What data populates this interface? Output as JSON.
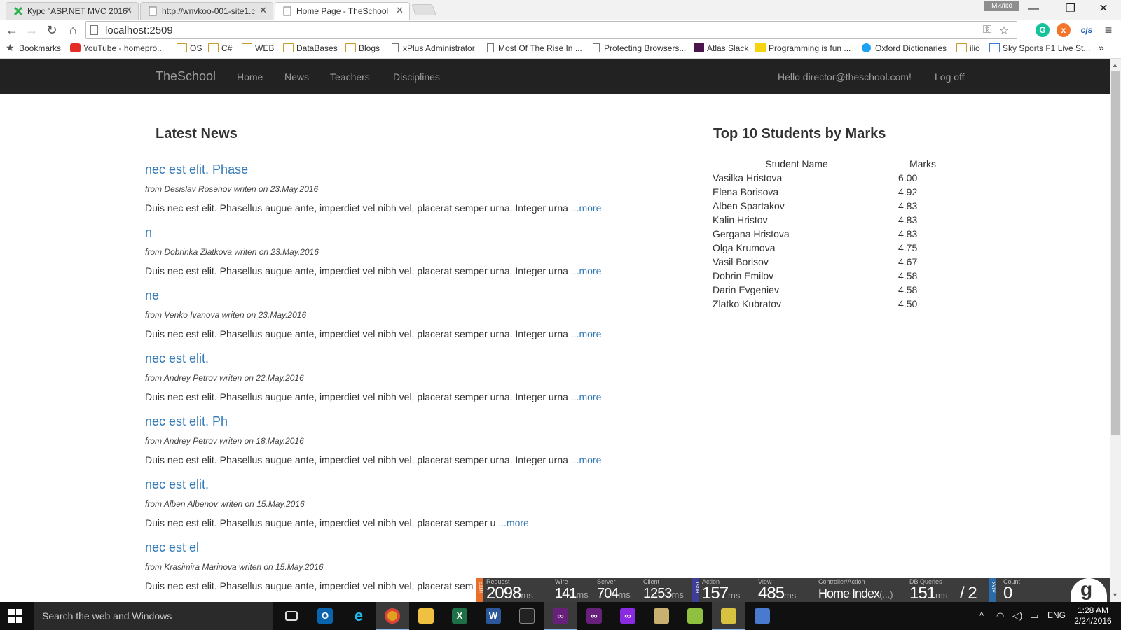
{
  "browser": {
    "tabs": [
      {
        "title": "Курс \"ASP.NET MVC 2016\"",
        "favicon_color": "#2bb24c",
        "active": false
      },
      {
        "title": "http://wnvkoo-001-site1.c",
        "favicon_color": "#777777",
        "active": false
      },
      {
        "title": "Home Page - TheSchool",
        "favicon_color": "#777777",
        "active": true
      }
    ],
    "user_badge": "Милко",
    "url": "localhost:2509",
    "extensions": {
      "grammarly": "G",
      "other": "x",
      "cjs": "cjs"
    },
    "bookmarks": [
      {
        "label": "Bookmarks",
        "icon": "star-icon"
      },
      {
        "label": "YouTube - homepro...",
        "icon": "youtube-icon"
      },
      {
        "label": "OS",
        "icon": "folder-icon"
      },
      {
        "label": "C#",
        "icon": "folder-icon"
      },
      {
        "label": "WEB",
        "icon": "folder-icon"
      },
      {
        "label": "DataBases",
        "icon": "folder-icon"
      },
      {
        "label": "Blogs",
        "icon": "folder-icon"
      },
      {
        "label": "xPlus Administrator",
        "icon": "page-icon"
      },
      {
        "label": "Most Of The Rise In ...",
        "icon": "page-icon"
      },
      {
        "label": "Protecting Browsers...",
        "icon": "page-icon"
      },
      {
        "label": "Atlas Slack",
        "icon": "slack-icon"
      },
      {
        "label": "Programming is fun ...",
        "icon": "programming-icon"
      },
      {
        "label": "Oxford Dictionaries",
        "icon": "oxford-icon"
      },
      {
        "label": "ilio",
        "icon": "folder-icon"
      },
      {
        "label": "Sky Sports F1 Live St...",
        "icon": "sky-icon"
      }
    ],
    "overflow_label": "»"
  },
  "site": {
    "brand": "TheSchool",
    "nav": [
      "Home",
      "News",
      "Teachers",
      "Disciplines"
    ],
    "greeting": "Hello director@theschool.com!",
    "logoff": "Log off"
  },
  "latest_news": {
    "heading": "Latest News",
    "items": [
      {
        "title": "nec est elit. Phase",
        "meta": "from Desislav Rosenov writen on 23.May.2016",
        "body": "Duis nec est elit. Phasellus augue ante, imperdiet vel nibh vel, placerat semper urna. Integer urna",
        "more": "...more"
      },
      {
        "title": "n",
        "meta": "from Dobrinka Zlatkova writen on 23.May.2016",
        "body": "Duis nec est elit. Phasellus augue ante, imperdiet vel nibh vel, placerat semper urna. Integer urna",
        "more": "...more"
      },
      {
        "title": "ne",
        "meta": "from Venko Ivanova writen on 23.May.2016",
        "body": "Duis nec est elit. Phasellus augue ante, imperdiet vel nibh vel, placerat semper urna. Integer urna",
        "more": "...more"
      },
      {
        "title": "nec est elit.",
        "meta": "from Andrey Petrov writen on 22.May.2016",
        "body": "Duis nec est elit. Phasellus augue ante, imperdiet vel nibh vel, placerat semper urna. Integer urna",
        "more": "...more"
      },
      {
        "title": "nec est elit. Ph",
        "meta": "from Andrey Petrov writen on 18.May.2016",
        "body": "Duis nec est elit. Phasellus augue ante, imperdiet vel nibh vel, placerat semper urna. Integer urna",
        "more": "...more"
      },
      {
        "title": "nec est elit.",
        "meta": "from Alben Albenov writen on 15.May.2016",
        "body": "Duis nec est elit. Phasellus augue ante, imperdiet vel nibh vel, placerat semper u",
        "more": "...more"
      },
      {
        "title": "nec est el",
        "meta": "from Krasimira Marinova writen on 15.May.2016",
        "body": "Duis nec est elit. Phasellus augue ante, imperdiet vel nibh vel, placerat sem",
        "more": ""
      }
    ]
  },
  "top_students": {
    "heading": "Top 10 Students by Marks",
    "columns": [
      "Student Name",
      "Marks"
    ],
    "rows": [
      [
        "Vasilka Hristova",
        "6.00"
      ],
      [
        "Elena Borisova",
        "4.92"
      ],
      [
        "Alben Spartakov",
        "4.83"
      ],
      [
        "Kalin Hristov",
        "4.83"
      ],
      [
        "Gergana Hristova",
        "4.83"
      ],
      [
        "Olga Krumova",
        "4.75"
      ],
      [
        "Vasil Borisov",
        "4.67"
      ],
      [
        "Dobrin Emilov",
        "4.58"
      ],
      [
        "Darin Evgeniev",
        "4.58"
      ],
      [
        "Zlatko Kubratov",
        "4.50"
      ]
    ]
  },
  "glimpse": {
    "http_tag": "HTTP",
    "host_tag": "HOST",
    "ajax_tag": "AJAX",
    "stats": [
      {
        "label": "Request",
        "value": "2098",
        "unit": "ms"
      },
      {
        "label": "Wire",
        "value": "141",
        "unit": "ms"
      },
      {
        "label": "Server",
        "value": "704",
        "unit": "ms"
      },
      {
        "label": "Client",
        "value": "1253",
        "unit": "ms"
      },
      {
        "label": "Action",
        "value": "157",
        "unit": "ms"
      },
      {
        "label": "View",
        "value": "485",
        "unit": "ms"
      },
      {
        "label": "Controller/Action",
        "value": "Home Index",
        "unit": "(...)"
      },
      {
        "label": "DB Queries",
        "value": "151",
        "unit": "ms"
      },
      {
        "label": "",
        "value": "/ 2",
        "unit": ""
      },
      {
        "label": "Count",
        "value": "0",
        "unit": ""
      }
    ],
    "logo": "g"
  },
  "taskbar": {
    "search_placeholder": "Search the web and Windows",
    "apps": [
      "task-view",
      "outlook",
      "internet-explorer",
      "chrome",
      "file-explorer",
      "excel",
      "word",
      "terminal",
      "visual-studio",
      "visual-studio",
      "visual-studio",
      "calculator",
      "notepad",
      "tools",
      "paint"
    ],
    "language": "ENG",
    "time": "1:28 AM",
    "date": "2/24/2016"
  }
}
